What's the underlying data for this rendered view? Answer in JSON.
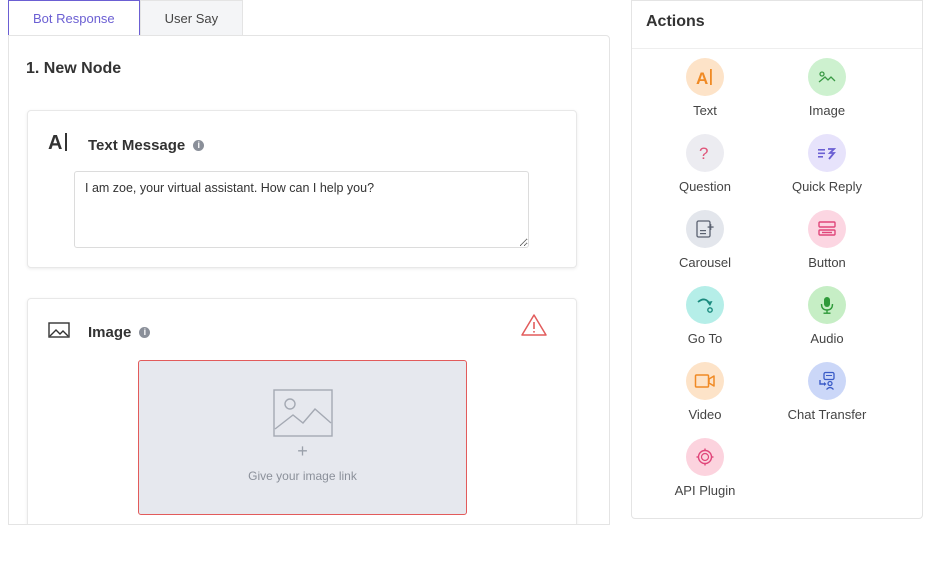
{
  "tabs": [
    {
      "label": "Bot Response",
      "active": true
    },
    {
      "label": "User Say",
      "active": false
    }
  ],
  "node": {
    "title": "1.  New Node"
  },
  "text_card": {
    "glyph": "A|",
    "title": "Text Message",
    "info": "i",
    "message": "I am zoe, your virtual assistant. How can I help you?"
  },
  "image_card": {
    "title": "Image",
    "info": "i",
    "plus": "+",
    "hint": "Give your image link"
  },
  "actions": {
    "title": "Actions",
    "items": [
      {
        "label": "Text",
        "icon": "text-icon",
        "bg": "#fde3c8",
        "fg": "#f08a24"
      },
      {
        "label": "Image",
        "icon": "image-icon",
        "bg": "#cdf1cf",
        "fg": "#3a9a45"
      },
      {
        "label": "Question",
        "icon": "question-icon",
        "bg": "#ececf1",
        "fg": "#e0567a"
      },
      {
        "label": "Quick Reply",
        "icon": "quick-reply-icon",
        "bg": "#e7e3fb",
        "fg": "#6b5fd3"
      },
      {
        "label": "Carousel",
        "icon": "carousel-icon",
        "bg": "#e3e6ec",
        "fg": "#5a6170"
      },
      {
        "label": "Button",
        "icon": "button-icon",
        "bg": "#fcd6e2",
        "fg": "#e0467a"
      },
      {
        "label": "Go To",
        "icon": "goto-icon",
        "bg": "#b5eee8",
        "fg": "#1a8a7e"
      },
      {
        "label": "Audio",
        "icon": "audio-icon",
        "bg": "#c6eec5",
        "fg": "#2f9a3a"
      },
      {
        "label": "Video",
        "icon": "video-icon",
        "bg": "#fde3c8",
        "fg": "#f08a24"
      },
      {
        "label": "Chat Transfer",
        "icon": "chat-transfer-icon",
        "bg": "#cbd7f8",
        "fg": "#3a5bc7"
      },
      {
        "label": "API Plugin",
        "icon": "api-plugin-icon",
        "bg": "#fcd3de",
        "fg": "#e0467a"
      }
    ]
  }
}
